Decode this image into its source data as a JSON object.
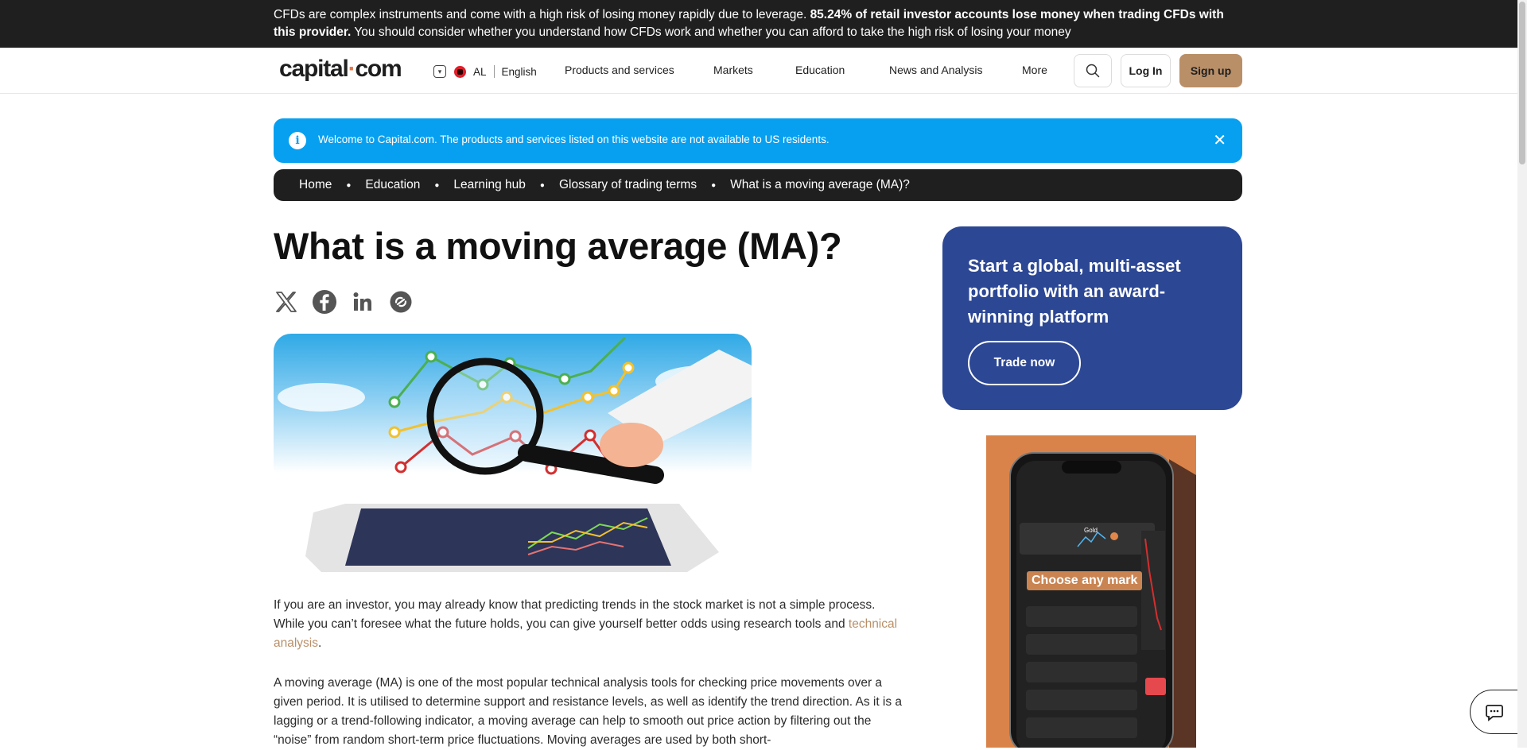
{
  "risk_warning": {
    "part1": "CFDs are complex instruments and come with a high risk of losing money rapidly due to leverage. ",
    "bold": "85.24% of retail investor accounts lose money when trading CFDs with this provider.",
    "part2": " You should consider whether you understand how CFDs work and whether you can afford to take the high risk of losing your money"
  },
  "header": {
    "logo_left": "capital",
    "logo_dot": "·",
    "logo_right": "com",
    "country": "AL",
    "language": "English",
    "nav": [
      "Products and services",
      "Markets",
      "Education",
      "News and Analysis",
      "More"
    ],
    "login": "Log In",
    "signup": "Sign up"
  },
  "banner": {
    "text": "Welcome to Capital.com. The products and services listed on this website are not available to US residents.",
    "close": "✕"
  },
  "breadcrumb": [
    "Home",
    "Education",
    "Learning hub",
    "Glossary of trading terms",
    "What is a moving average (MA)?"
  ],
  "article": {
    "title": "What is a moving average (MA)?",
    "para1_start": "If you are an investor, you may already know that predicting trends in the stock market is not a simple process. While you can’t foresee what the future holds, you can give yourself better odds using research tools and ",
    "para1_link": "technical analysis",
    "para1_end": ".",
    "para2": "A moving average (MA) is one of the most popular technical analysis tools for checking price movements over a given period. It is utilised to determine support and resistance levels, as well as identify the trend direction. As it is a lagging or a trend-following indicator, a moving average can help to smooth out price action by filtering out the “noise” from random short-term price fluctuations. Moving averages are used by both short-"
  },
  "promo": {
    "title": "Start a global, multi-asset portfolio with an award-winning platform",
    "button": "Trade now"
  },
  "ad": {
    "label": "Choose any mark",
    "asset": "Gold"
  }
}
